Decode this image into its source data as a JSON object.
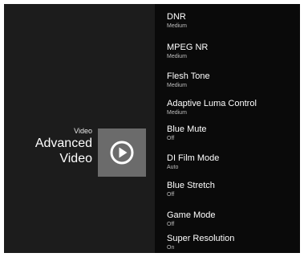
{
  "header": {
    "category": "Video",
    "title_line1": "Advanced",
    "title_line2": "Video"
  },
  "tile": {
    "icon": "play-circle-icon"
  },
  "menu": {
    "items": [
      {
        "label": "DNR",
        "value": "Medium"
      },
      {
        "label": "MPEG NR",
        "value": "Medium"
      },
      {
        "label": "Flesh Tone",
        "value": "Medium"
      },
      {
        "label": "Adaptive Luma Control",
        "value": "Medium"
      },
      {
        "label": "Blue Mute",
        "value": "Off"
      },
      {
        "label": "DI Film Mode",
        "value": "Auto"
      },
      {
        "label": "Blue Stretch",
        "value": "Off"
      },
      {
        "label": "Game Mode",
        "value": "Off"
      },
      {
        "label": "Super Resolution",
        "value": "On"
      }
    ]
  },
  "colors": {
    "left_panel": "#1c1c1c",
    "right_panel": "#0a0a0a",
    "tile": "#6b6b6b",
    "text": "#ffffff",
    "subtext": "#bdbdbd"
  }
}
